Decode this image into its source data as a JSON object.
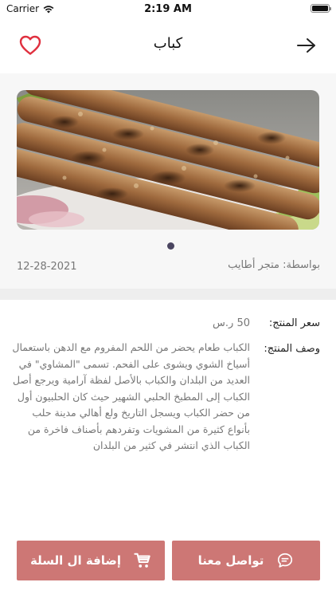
{
  "status_bar": {
    "carrier": "Carrier",
    "time": "2:19 AM"
  },
  "nav": {
    "title": "كباب",
    "favorite_icon": "heart-icon",
    "back_icon": "arrow-right-icon"
  },
  "product": {
    "image_icon": "kebab-photo",
    "store": "بواسطة: متجر أطايب",
    "date": "12-28-2021",
    "price_label": "سعر المنتج:",
    "price_value": "50 ر.س",
    "description_label": "وصف المنتج:",
    "description": "الكباب طعام يحضر من اللحم المفروم مع الدهن باستعمال أسياخ الشوي ويشوى على الفحم. تسمى \"المشاوي\" في العديد من البلدان والكباب بالأصل لفظة آرامية ويرجع أصل الكباب إلى المطبخ الحلبي الشهير حيث كان الحلبيون أول من حضر الكباب ويسجل التاريخ ولع أهالي مدينة حلب بأنواع كثيرة من المشويات وتفردهم بأصناف فاخرة من الكباب الذي انتشر في كثير من البلدان"
  },
  "actions": {
    "add_to_cart_label": "إضافة ال السلة",
    "contact_label": "تواصل معنا",
    "cart_icon": "cart-icon",
    "chat_icon": "chat-icon"
  },
  "colors": {
    "accent": "#cd7775",
    "heart": "#e0303f",
    "dot": "#4a4560"
  }
}
